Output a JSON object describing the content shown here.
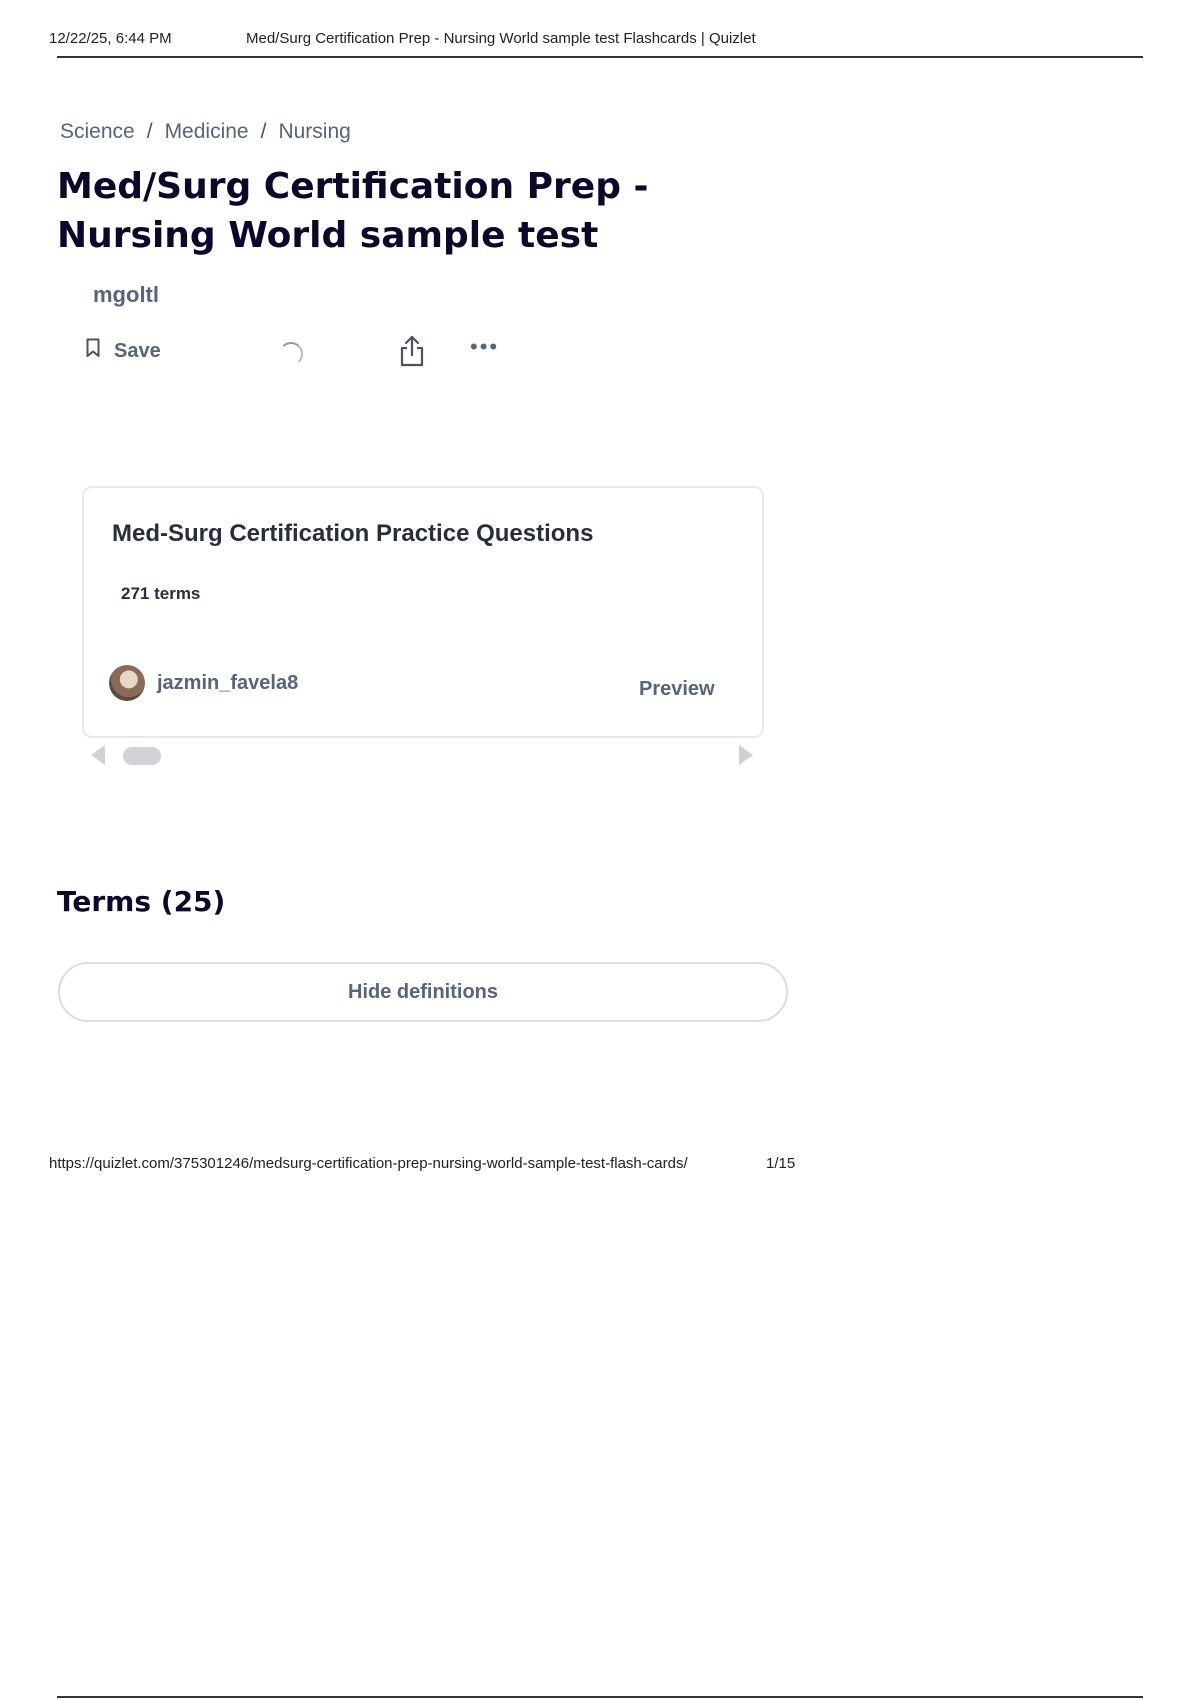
{
  "print_header": {
    "datetime": "12/22/25, 6:44 PM",
    "tab_title": "Med/Surg Certification Prep - Nursing World sample test Flashcards | Quizlet"
  },
  "breadcrumb": {
    "items": [
      "Science",
      "Medicine",
      "Nursing"
    ],
    "separator": "/"
  },
  "set": {
    "title": "Med/Surg Certification Prep - Nursing World sample test",
    "author": "mgoltl"
  },
  "actions": {
    "save_label": "Save",
    "bookmark_icon": "bookmark-icon",
    "share_icon": "share-icon",
    "more_label": "•••"
  },
  "related_card": {
    "title": "Med-Surg Certification Practice Questions",
    "terms_count": "271 terms",
    "username": "jazmin_favela8",
    "preview_label": "Preview"
  },
  "terms_section": {
    "heading": "Terms (25)",
    "toggle_label": "Hide definitions"
  },
  "print_footer": {
    "url": "https://quizlet.com/375301246/medsurg-certification-prep-nursing-world-sample-test-flash-cards/",
    "page": "1/15"
  },
  "colors": {
    "muted_text": "#586380",
    "heading_text": "#0a092d",
    "card_border": "#e6e8ef"
  }
}
